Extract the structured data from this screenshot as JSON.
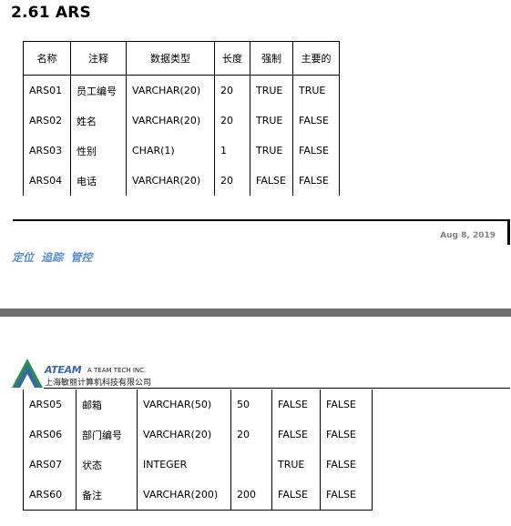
{
  "section_title": "2.61 ARS",
  "table": {
    "headers": [
      "名称",
      "注释",
      "数据类型",
      "长度",
      "强制",
      "主要的"
    ],
    "rows_page1": [
      [
        "ARS01",
        "员工编号",
        "VARCHAR(20)",
        "20",
        "TRUE",
        "TRUE"
      ],
      [
        "ARS02",
        "姓名",
        "VARCHAR(20)",
        "20",
        "TRUE",
        "FALSE"
      ],
      [
        "ARS03",
        "性别",
        "CHAR(1)",
        "1",
        "TRUE",
        "FALSE"
      ],
      [
        "ARS04",
        "电话",
        "VARCHAR(20)",
        "20",
        "FALSE",
        "FALSE"
      ]
    ],
    "rows_page2": [
      [
        "ARS05",
        "邮箱",
        "VARCHAR(50)",
        "50",
        "FALSE",
        "FALSE"
      ],
      [
        "ARS06",
        "部门编号",
        "VARCHAR(20)",
        "20",
        "FALSE",
        "FALSE"
      ],
      [
        "ARS07",
        "状态",
        "INTEGER",
        "",
        "TRUE",
        "FALSE"
      ],
      [
        "ARS60",
        "备注",
        "VARCHAR(200)",
        "200",
        "FALSE",
        "FALSE"
      ]
    ]
  },
  "footer": {
    "date": "Aug 8, 2019",
    "slogan": "定位 追踪 管控"
  },
  "header": {
    "logo_name": "ATEAM",
    "logo_tagline": "A TEAM TECH INC.",
    "company_cn": "上海敏丽计算机科技有限公司"
  },
  "colors": {
    "slogan": "#5b8fc9",
    "logo_blue": "#3a67a8",
    "logo_green": "#2e8b57",
    "page_separator": "#6e6e6e"
  }
}
